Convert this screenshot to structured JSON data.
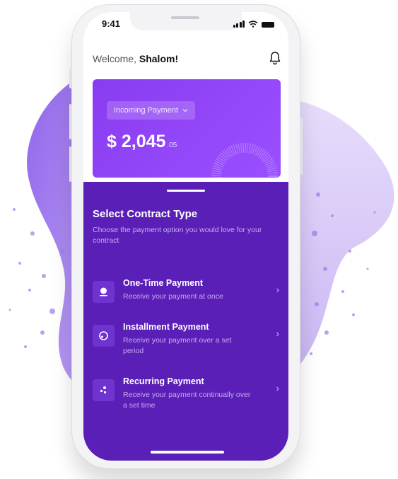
{
  "status_bar": {
    "time": "9:41"
  },
  "header": {
    "greeting": "Welcome,",
    "user_name": "Shalom!"
  },
  "balance_card": {
    "dropdown_label": "Incoming Payment",
    "amount_main": "$ 2,045",
    "amount_cents": ".05"
  },
  "sheet": {
    "title": "Select Contract Type",
    "subtitle": "Choose the payment option you would love for your contract",
    "options": [
      {
        "title": "One-Time Payment",
        "desc": "Receive your payment at once",
        "icon": "one-time-icon"
      },
      {
        "title": "Installment Payment",
        "desc": "Receive your payment over a set period",
        "icon": "installment-icon"
      },
      {
        "title": "Recurring Payment",
        "desc": "Receive your payment continually over a set time",
        "icon": "recurring-icon"
      }
    ]
  },
  "colors": {
    "primary": "#5a1fb7",
    "card": "#8a3cf0",
    "accent_light": "#c4acf0"
  }
}
